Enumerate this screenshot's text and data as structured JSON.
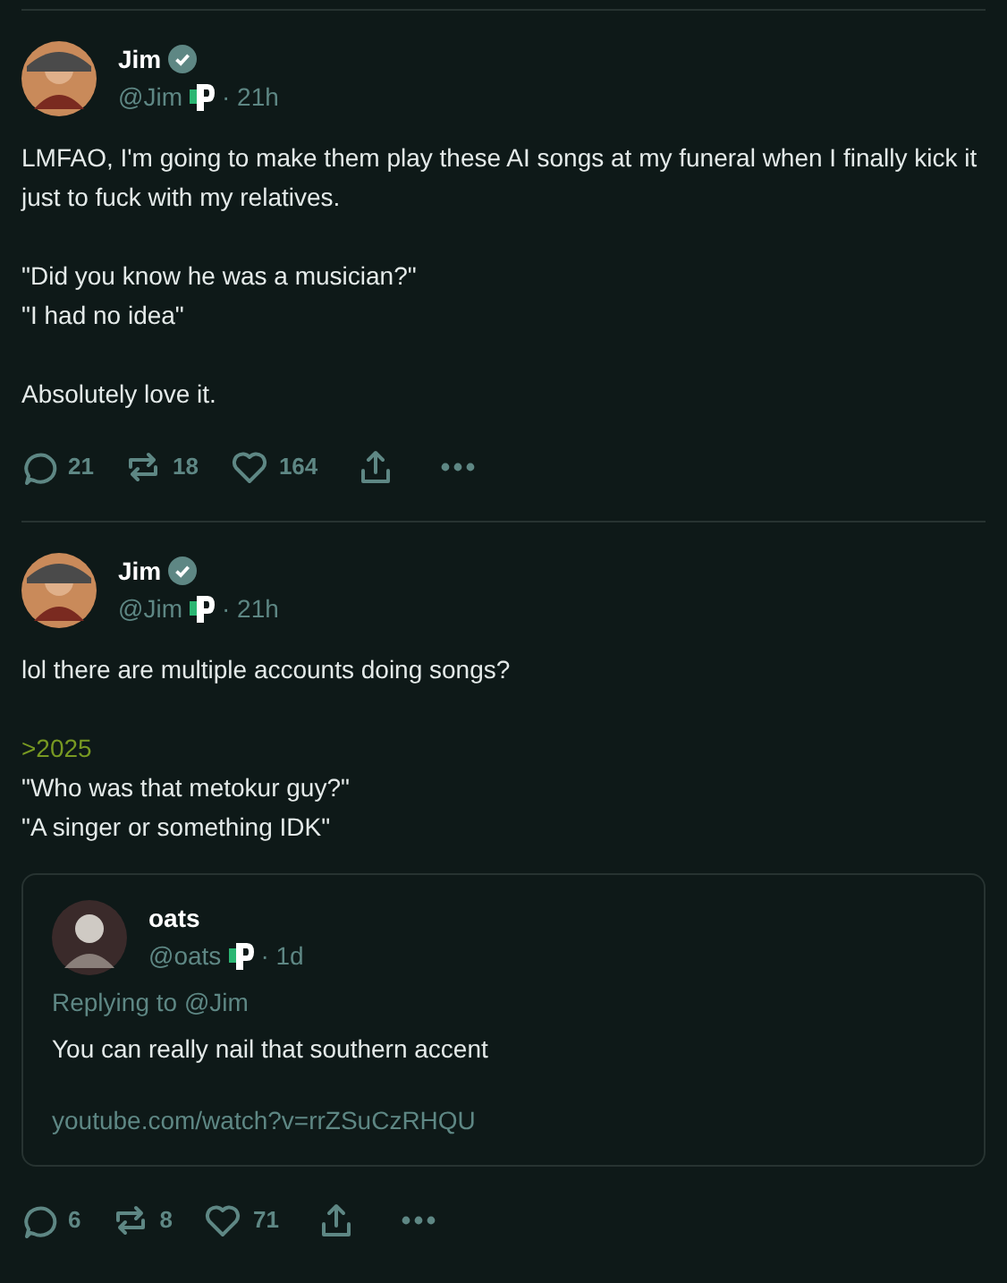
{
  "posts": [
    {
      "author": {
        "name": "Jim",
        "verified": true,
        "handle": "@Jim",
        "time": "· 21h"
      },
      "paragraphs": [
        [
          {
            "kind": "text",
            "text": "LMFAO, I'm going to make them play these AI songs at my funeral when I finally kick it just to fuck with my relatives."
          }
        ],
        [
          {
            "kind": "text",
            "text": "\"Did you know he was a musician?\""
          },
          {
            "kind": "text",
            "text": "\"I had no idea\""
          }
        ],
        [
          {
            "kind": "text",
            "text": "Absolutely love it."
          }
        ]
      ],
      "actions": {
        "replies": "21",
        "reposts": "18",
        "likes": "164"
      }
    },
    {
      "author": {
        "name": "Jim",
        "verified": true,
        "handle": "@Jim",
        "time": "· 21h"
      },
      "paragraphs": [
        [
          {
            "kind": "text",
            "text": "lol there are multiple accounts doing songs?"
          }
        ],
        [
          {
            "kind": "greentext",
            "text": ">2025"
          },
          {
            "kind": "text",
            "text": "\"Who was that metokur guy?\""
          },
          {
            "kind": "text",
            "text": "\"A singer or something IDK\""
          }
        ]
      ],
      "quote": {
        "author": {
          "name": "oats",
          "handle": "@oats",
          "time": "· 1d"
        },
        "replying_prefix": "Replying to",
        "replying_to": "@Jim",
        "text": "You can really nail that southern accent",
        "link": "youtube.com/watch?v=rrZSuCzRHQU"
      },
      "actions": {
        "replies": "6",
        "reposts": "8",
        "likes": "71"
      }
    }
  ]
}
